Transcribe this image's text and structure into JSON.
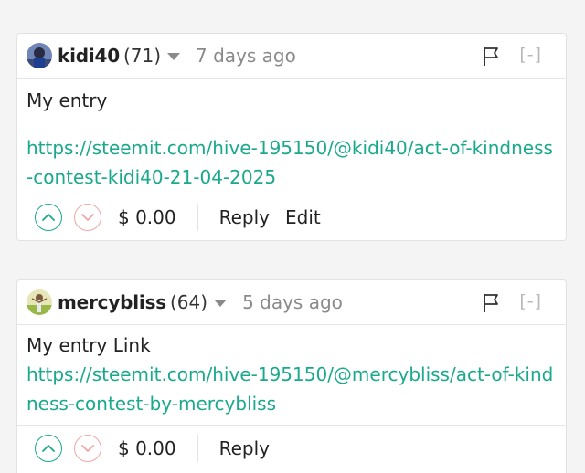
{
  "comments": [
    {
      "author": "kidi40",
      "reputation": "(71)",
      "time": "7 days ago",
      "collapse": "[-]",
      "body": "My entry",
      "link": "https://steemit.com/hive-195150/@kidi40/act-of-kindness-contest-kidi40-21-04-2025",
      "payout": "$ 0.00",
      "reply_label": "Reply",
      "edit_label": "Edit"
    },
    {
      "author": "mercybliss",
      "reputation": "(64)",
      "time": "5 days ago",
      "collapse": "[-]",
      "body": "My entry Link",
      "link": "https://steemit.com/hive-195150/@mercybliss/act-of-kindness-contest-by-mercybliss",
      "payout": "$ 0.00",
      "reply_label": "Reply"
    }
  ],
  "colors": {
    "link": "#1aa98c",
    "upvote": "#1aa98c",
    "downvote": "#f0a6a6"
  },
  "icons": [
    "avatar",
    "chevron-down-icon",
    "flag-icon",
    "upvote-icon",
    "downvote-icon"
  ]
}
